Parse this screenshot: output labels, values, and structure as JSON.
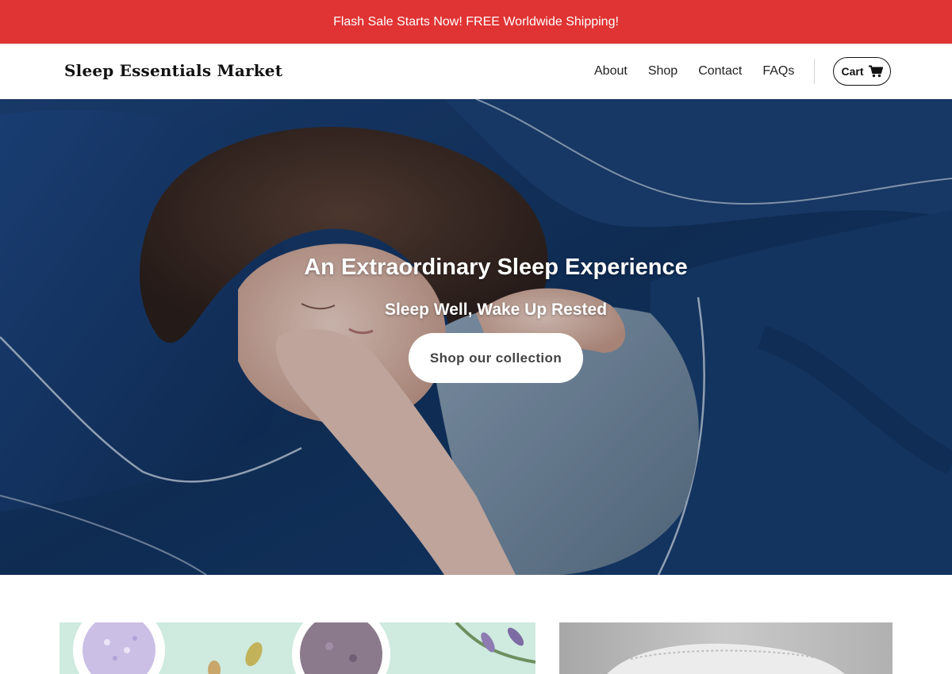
{
  "announcement": {
    "text": "Flash Sale Starts Now! FREE Worldwide Shipping!"
  },
  "header": {
    "logo": "Sleep Essentials Market",
    "nav": [
      {
        "label": "About"
      },
      {
        "label": "Shop"
      },
      {
        "label": "Contact"
      },
      {
        "label": "FAQs"
      }
    ],
    "cart_label": "Cart",
    "cart_icon": "shopping-cart-icon"
  },
  "hero": {
    "title": "An Extraordinary Sleep Experience",
    "subtitle": "Sleep Well, Wake Up Rested",
    "cta_label": "Shop our collection",
    "image": "woman-sleeping-on-blue-bedding"
  },
  "collections": [
    {
      "image": "lavender-salts-and-herbs"
    },
    {
      "image": "white-pillow-closeup"
    }
  ],
  "colors": {
    "announcement_bg": "#e03333",
    "hero_bedding": "#123766",
    "button_bg": "#ffffff",
    "button_text": "#444444"
  }
}
